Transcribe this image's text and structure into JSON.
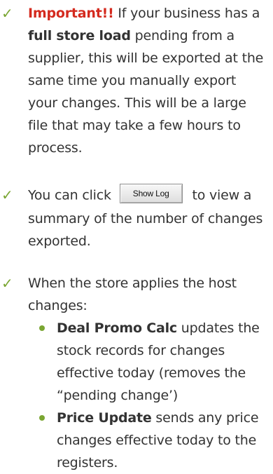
{
  "items": [
    {
      "check_icon": "check-mark-icon",
      "important_label": "Important!!",
      "p1": " If your business has a ",
      "bold1": "full store load",
      "p2": " pending from a supplier, this will be exported at the same time you manually export your changes.  This will be a large file that may take a few hours to process."
    },
    {
      "check_icon": "check-mark-icon",
      "before_button": "You can click ",
      "button_label": "Show Log",
      "after_button": " to view a summary of the number of changes exported."
    },
    {
      "check_icon": "check-mark-icon",
      "text": "When the store applies the host changes:",
      "subitems": [
        {
          "bold": "Deal Promo Calc",
          "text": " updates the stock records for changes effective today (removes the “pending change’)"
        },
        {
          "bold": "Price Update",
          "text": " sends any price changes effective today to the registers."
        }
      ]
    }
  ],
  "colors": {
    "accent_green": "#7aa632",
    "important_red": "#d42a1e",
    "body_text": "#333333"
  }
}
